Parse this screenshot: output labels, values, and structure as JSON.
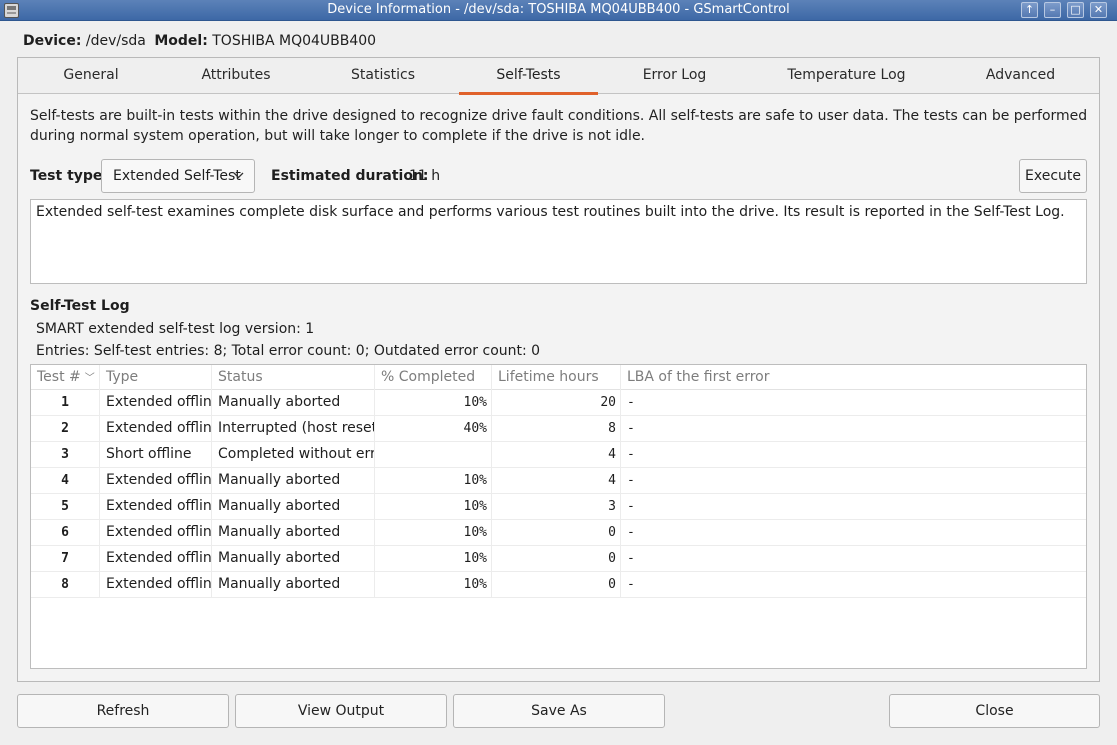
{
  "window": {
    "title": "Device Information - /dev/sda: TOSHIBA MQ04UBB400 - GSmartControl",
    "buttons": {
      "up": "↑",
      "minimize": "–",
      "maximize": "□",
      "close": "✕"
    }
  },
  "device": {
    "device_label": "Device:",
    "device_value": "/dev/sda",
    "model_label": "Model:",
    "model_value": "TOSHIBA MQ04UBB400"
  },
  "tabs": [
    {
      "label": "General"
    },
    {
      "label": "Attributes"
    },
    {
      "label": "Statistics"
    },
    {
      "label": "Self-Tests"
    },
    {
      "label": "Error Log"
    },
    {
      "label": "Temperature Log"
    },
    {
      "label": "Advanced"
    }
  ],
  "selftests": {
    "description": "Self-tests are built-in tests within the drive designed to recognize drive fault conditions. All self-tests are safe to user data. The tests can be performed during normal system operation, but will take longer to complete if the drive is not idle.",
    "test_type_label": "Test type:",
    "test_type_value": "Extended Self-Test",
    "estimated_duration_label": "Estimated duration:",
    "estimated_duration_value": "11 h",
    "execute_label": "Execute",
    "test_description": "Extended self-test examines complete disk surface and performs various test routines built into the drive. Its result is reported in the Self-Test Log.",
    "log_title": "Self-Test Log",
    "log_version": "SMART extended self-test log version: 1",
    "log_entries": "Entries: Self-test entries: 8; Total error count: 0; Outdated error count: 0"
  },
  "table": {
    "columns": [
      "Test #",
      "Type",
      "Status",
      "% Completed",
      "Lifetime hours",
      "LBA of the first error"
    ],
    "rows": [
      [
        "1",
        "Extended offline",
        "Manually aborted",
        "10%",
        "20",
        "-"
      ],
      [
        "2",
        "Extended offline",
        "Interrupted (host reset)",
        "40%",
        "8",
        "-"
      ],
      [
        "3",
        "Short offline",
        "Completed without error",
        "",
        "4",
        "-"
      ],
      [
        "4",
        "Extended offline",
        "Manually aborted",
        "10%",
        "4",
        "-"
      ],
      [
        "5",
        "Extended offline",
        "Manually aborted",
        "10%",
        "3",
        "-"
      ],
      [
        "6",
        "Extended offline",
        "Manually aborted",
        "10%",
        "0",
        "-"
      ],
      [
        "7",
        "Extended offline",
        "Manually aborted",
        "10%",
        "0",
        "-"
      ],
      [
        "8",
        "Extended offline",
        "Manually aborted",
        "10%",
        "0",
        "-"
      ]
    ]
  },
  "footer": {
    "refresh_label": "Refresh",
    "view_output_label": "View Output",
    "save_as_label": "Save As",
    "close_label": "Close"
  },
  "colors": {
    "titlebar": "#3d68a6",
    "active_tab_underline": "#e0612b"
  }
}
